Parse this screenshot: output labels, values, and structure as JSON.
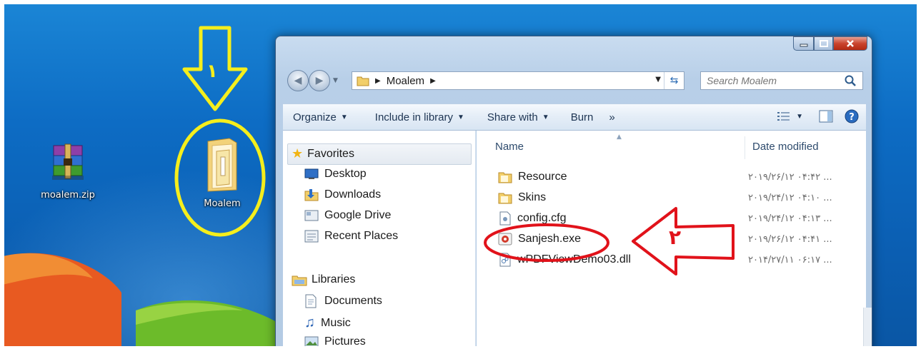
{
  "desktop": {
    "icons": [
      {
        "label": "moalem.zip"
      },
      {
        "label": "Moalem"
      }
    ],
    "annotations": [
      {
        "digit": "١"
      },
      {
        "digit": "٢"
      }
    ]
  },
  "window": {
    "address": {
      "path": "Moalem",
      "search_placeholder": "Search Moalem"
    },
    "toolbar": {
      "organize": "Organize",
      "include": "Include in library",
      "share": "Share with",
      "burn": "Burn",
      "more": "»"
    },
    "navpane": {
      "favorites": "Favorites",
      "items": [
        "Desktop",
        "Downloads",
        "Google Drive",
        "Recent Places"
      ],
      "libraries": "Libraries",
      "library_items": [
        "Documents",
        "Music",
        "Pictures"
      ]
    },
    "columns": {
      "name": "Name",
      "date": "Date modified"
    },
    "files": [
      {
        "name": "Resource",
        "date": "۲۰۱۹/۲۶/۱۲ ۰۴:۴۲ ...",
        "icon": "folder-icon"
      },
      {
        "name": "Skins",
        "date": "۲۰۱۹/۲۴/۱۲ ۰۴:۱۰ ...",
        "icon": "folder-icon"
      },
      {
        "name": "config.cfg",
        "date": "۲۰۱۹/۲۴/۱۲ ۰۴:۱۳ ...",
        "icon": "config-file-icon"
      },
      {
        "name": "Sanjesh.exe",
        "date": "۲۰۱۹/۲۶/۱۲ ۰۴:۴۱ ...",
        "icon": "exe-file-icon"
      },
      {
        "name": "wPDFViewDemo03.dll",
        "date": "۲۰۱۴/۲۷/۱۱ ۰۶:۱۷ ...",
        "icon": "dll-file-icon"
      }
    ]
  },
  "colors": {
    "annotation_yellow": "#f5ee1c",
    "annotation_red": "#e1121a"
  }
}
